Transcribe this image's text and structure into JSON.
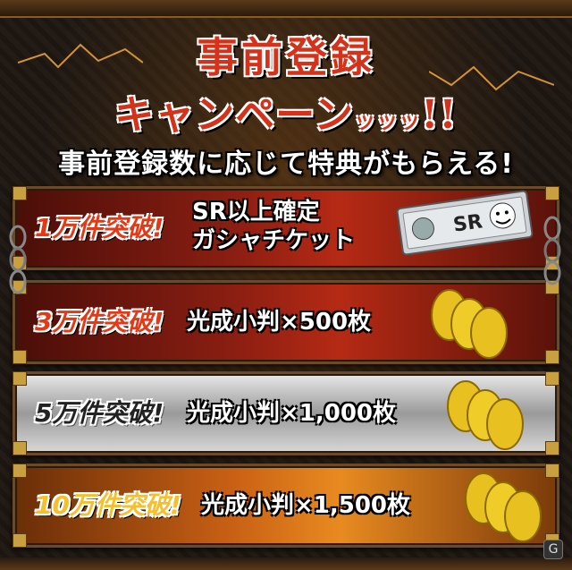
{
  "title": {
    "line1": "事前登録",
    "line2_main": "キャンペーン",
    "line2_small": "ッッッ",
    "line2_mark": "!!"
  },
  "subtitle": "事前登録数に応じて特典がもらえる!",
  "rewards": [
    {
      "milestone": "1万件突破!",
      "line1": "SR以上確定",
      "line2": "ガシャチケット",
      "ticket_label": "SR"
    },
    {
      "milestone": "3万件突破!",
      "line1": "光成小判×500枚"
    },
    {
      "milestone": "5万件突破!",
      "line1": "光成小判×1,000枚"
    },
    {
      "milestone": "10万件突破!",
      "line1": "光成小判×1,500枚"
    }
  ],
  "colors": {
    "red_band": "#8a1e12",
    "silver_band": "#bdbdbd",
    "orange_band": "#c86014",
    "coin_gold": "#e8c020"
  },
  "icons": {
    "ticket": "gacha-ticket-icon",
    "coins": "koban-coins-icon",
    "chain": "chain-icon",
    "logo": "site-logo-icon"
  }
}
